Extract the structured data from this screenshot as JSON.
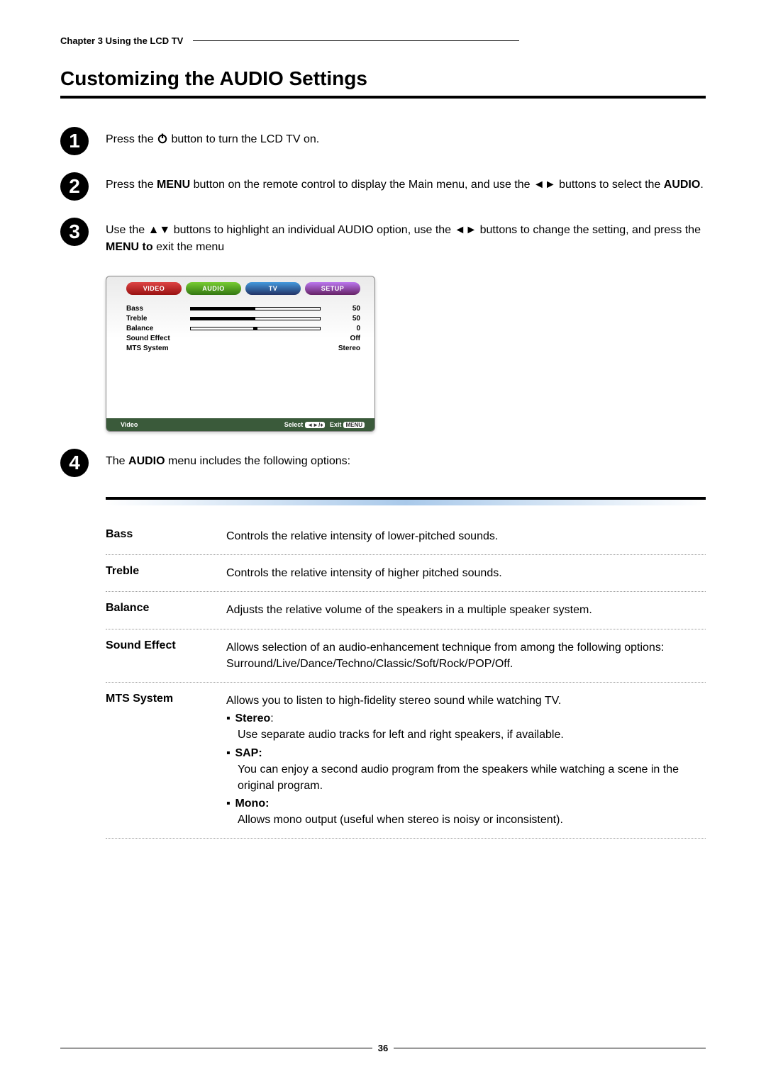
{
  "chapter_header": "Chapter 3 Using the LCD TV",
  "title": "Customizing the AUDIO Settings",
  "steps": {
    "s1_a": "Press the ",
    "s1_b": " button to turn the LCD TV on.",
    "s2_a": "Press the ",
    "s2_b": "MENU",
    "s2_c": " button on the remote control to display the Main menu, and use the ◄► buttons to select the ",
    "s2_d": "AUDIO",
    "s2_e": ".",
    "s3_a": "Use the ▲▼ buttons to highlight an individual AUDIO option, use the ◄► buttons to change the setting, and press the ",
    "s3_b": "MENU to",
    "s3_c": " exit the menu",
    "s4_a": "The ",
    "s4_b": "AUDIO",
    "s4_c": " menu includes the following options:"
  },
  "screenshot": {
    "tabs": {
      "video": "VIDEO",
      "audio": "AUDIO",
      "tv": "TV",
      "setup": "SETUP"
    },
    "rows": [
      {
        "label": "Bass",
        "value": "50",
        "bar": "50"
      },
      {
        "label": "Treble",
        "value": "50",
        "bar": "50"
      },
      {
        "label": "Balance",
        "value": "0",
        "bar": "mid"
      },
      {
        "label": "Sound Effect",
        "value": "Off",
        "bar": ""
      },
      {
        "label": "MTS System",
        "value": "Stereo",
        "bar": ""
      }
    ],
    "footer": {
      "left": "Video",
      "select_label": "Select",
      "select_badge": "◄►/♦",
      "exit_label": "Exit",
      "exit_badge": "MENU"
    }
  },
  "options": {
    "bass_label": "Bass",
    "bass_desc": "Controls the relative intensity of lower-pitched sounds.",
    "treble_label": "Treble",
    "treble_desc": "Controls the relative intensity of higher pitched sounds.",
    "balance_label": "Balance",
    "balance_desc": "Adjusts the relative volume of the speakers in a multiple speaker system.",
    "sound_label": "Sound Effect",
    "sound_desc": "Allows selection of an audio-enhancement technique from among the following options: Surround/Live/Dance/Techno/Classic/Soft/Rock/POP/Off.",
    "mts_label": "MTS System",
    "mts_intro": "Allows you to listen to high-fidelity stereo sound while watching TV.",
    "mts_stereo_h": "Stereo",
    "mts_stereo_b": "Use separate audio tracks for left and right speakers, if available.",
    "mts_sap_h": "SAP:",
    "mts_sap_b": "You can enjoy a second audio program from the speakers while watching a scene in the original program.",
    "mts_mono_h": "Mono:",
    "mts_mono_b": "Allows mono output (useful when stereo is noisy or inconsistent)."
  },
  "page_number": "36"
}
